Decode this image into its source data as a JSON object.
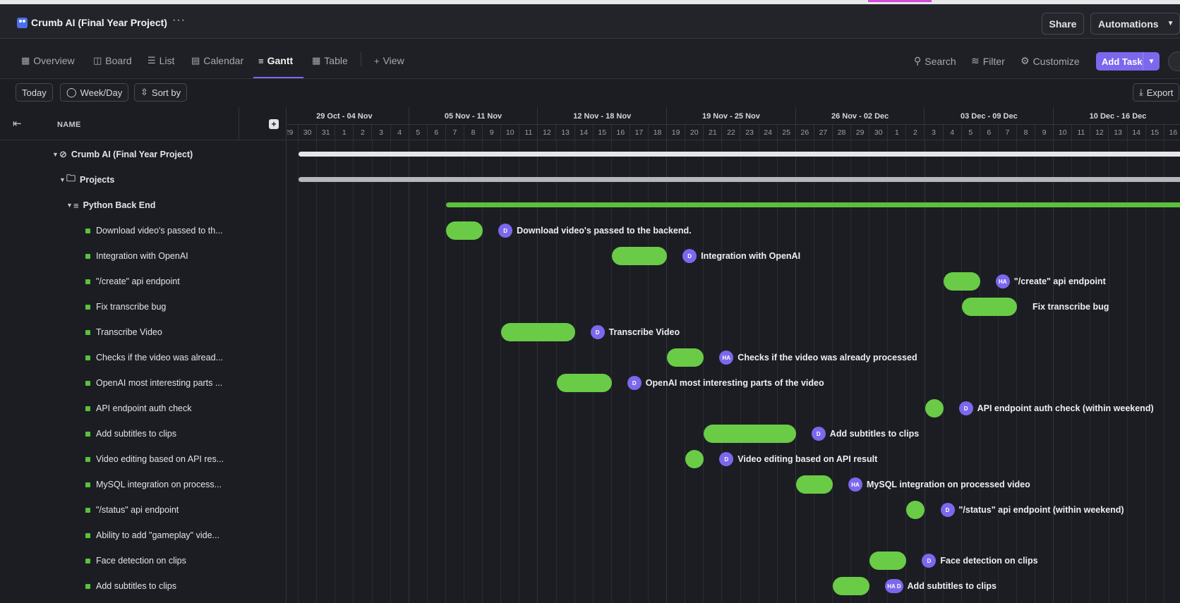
{
  "header": {
    "title": "Crumb AI (Final Year Project)",
    "more": "···",
    "share": "Share",
    "automations": "Automations"
  },
  "views": [
    {
      "label": "Overview",
      "icon": "overview-icon"
    },
    {
      "label": "Board",
      "icon": "board-icon"
    },
    {
      "label": "List",
      "icon": "list-icon"
    },
    {
      "label": "Calendar",
      "icon": "calendar-icon"
    },
    {
      "label": "Gantt",
      "icon": "gantt-icon",
      "active": true
    },
    {
      "label": "Table",
      "icon": "table-icon"
    },
    {
      "label": "View",
      "icon": "plus-icon"
    }
  ],
  "tools": {
    "search": "Search",
    "filter": "Filter",
    "customize": "Customize",
    "add_task": "Add Task"
  },
  "toolbar": {
    "today": "Today",
    "weekday": "Week/Day",
    "sortby": "Sort by",
    "export": "Export"
  },
  "list": {
    "name_header": "NAME",
    "rows": [
      {
        "label": "Crumb AI (Final Year Project)",
        "kind": "space"
      },
      {
        "label": "Projects",
        "kind": "folder"
      },
      {
        "label": "Python Back End",
        "kind": "list"
      },
      {
        "label": "Download video's passed to th..."
      },
      {
        "label": "Integration with OpenAI"
      },
      {
        "label": "\"/create\" api endpoint"
      },
      {
        "label": "Fix transcribe bug"
      },
      {
        "label": "Transcribe Video"
      },
      {
        "label": "Checks if the video was alread..."
      },
      {
        "label": "OpenAI most interesting parts ..."
      },
      {
        "label": "API endpoint auth check"
      },
      {
        "label": "Add subtitles to clips"
      },
      {
        "label": "Video editing based on API res..."
      },
      {
        "label": "MySQL integration on process..."
      },
      {
        "label": "\"/status\" api endpoint"
      },
      {
        "label": "Ability to add \"gameplay\" vide..."
      },
      {
        "label": "Face detection on clips"
      },
      {
        "label": "Add subtitles to clips"
      }
    ]
  },
  "timeline": {
    "weeks": [
      "29 Oct - 04 Nov",
      "05 Nov - 11 Nov",
      "12 Nov - 18 Nov",
      "19 Nov - 25 Nov",
      "26 Nov - 02 Dec",
      "03 Dec - 09 Dec",
      "10 Dec - 16 Dec"
    ],
    "days": [
      "29",
      "30",
      "31",
      "1",
      "2",
      "3",
      "4",
      "5",
      "6",
      "7",
      "8",
      "9",
      "10",
      "11",
      "12",
      "13",
      "14",
      "15",
      "16",
      "17",
      "18",
      "19",
      "20",
      "21",
      "22",
      "23",
      "24",
      "25",
      "26",
      "27",
      "28",
      "29",
      "30",
      "1",
      "2",
      "3",
      "4",
      "5",
      "6",
      "7",
      "8",
      "9",
      "10",
      "11",
      "12",
      "13",
      "14",
      "15",
      "16"
    ],
    "summary_bars": [
      {
        "row": 0,
        "start": 1,
        "end": 49,
        "color": "#e6e6e8"
      },
      {
        "row": 1,
        "start": 1,
        "end": 49,
        "color": "#b7b7bb"
      },
      {
        "row": 2,
        "start": 9,
        "end": 49,
        "color": "#5ac13e"
      }
    ],
    "tasks": [
      {
        "row": 3,
        "start": 9,
        "end": 11,
        "assignees": [
          "D"
        ],
        "label": "Download video's passed to the backend."
      },
      {
        "row": 4,
        "start": 18,
        "end": 21,
        "assignees": [
          "D"
        ],
        "label": "Integration with OpenAI"
      },
      {
        "row": 5,
        "start": 36,
        "end": 38,
        "assignees": [
          "HA"
        ],
        "label": "\"/create\" api endpoint"
      },
      {
        "row": 6,
        "start": 37,
        "end": 40,
        "assignees": [],
        "label": "Fix transcribe bug"
      },
      {
        "row": 7,
        "start": 12,
        "end": 16,
        "assignees": [
          "D"
        ],
        "label": "Transcribe Video"
      },
      {
        "row": 8,
        "start": 21,
        "end": 23,
        "assignees": [
          "HA"
        ],
        "label": "Checks if the video was already processed"
      },
      {
        "row": 9,
        "start": 15,
        "end": 18,
        "assignees": [
          "D"
        ],
        "label": "OpenAI most interesting parts of the video"
      },
      {
        "row": 10,
        "start": 35,
        "end": 36,
        "assignees": [
          "D"
        ],
        "label": "API endpoint auth check (within weekend)"
      },
      {
        "row": 11,
        "start": 23,
        "end": 28,
        "assignees": [
          "D"
        ],
        "label": "Add subtitles to clips"
      },
      {
        "row": 12,
        "start": 22,
        "end": 23,
        "assignees": [
          "D"
        ],
        "label": "Video editing based on API result"
      },
      {
        "row": 13,
        "start": 28,
        "end": 30,
        "assignees": [
          "HA"
        ],
        "label": "MySQL integration on processed video"
      },
      {
        "row": 14,
        "start": 34,
        "end": 35,
        "assignees": [
          "D"
        ],
        "label": "\"/status\" api endpoint (within weekend)"
      },
      {
        "row": 16,
        "start": 32,
        "end": 34,
        "assignees": [
          "D"
        ],
        "label": "Face detection on clips"
      },
      {
        "row": 17,
        "start": 30,
        "end": 32,
        "assignees": [
          "HA",
          "D"
        ],
        "label": "Add subtitles to clips"
      }
    ]
  }
}
